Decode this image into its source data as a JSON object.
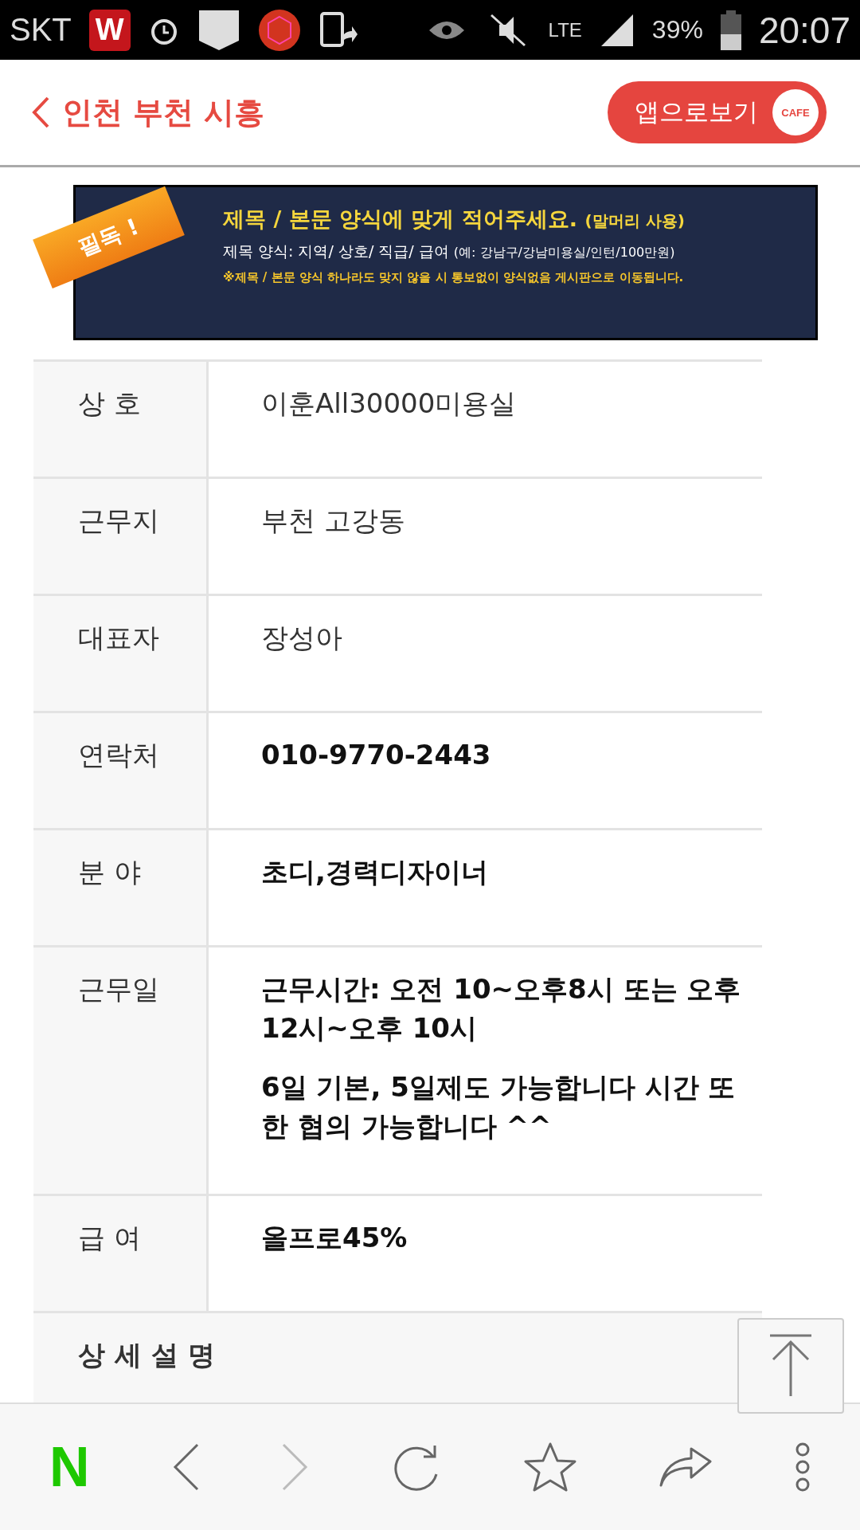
{
  "status_bar": {
    "carrier": "SKT",
    "app_badge": "W",
    "network": "LTE",
    "battery": "39%",
    "time": "20:07"
  },
  "header": {
    "back_label": "인천 부천 시흥",
    "app_button": "앱으로보기",
    "cafe_logo": "CAFE"
  },
  "notice_banner": {
    "ribbon": "필독 !",
    "headline": "제목 / 본문 양식에 맞게 적어주세요.",
    "headline_note": "(말머리 사용)",
    "format_line": "제목 양식: 지역/ 상호/ 직급/ 급여",
    "format_example": "(예: 강남구/강남미용실/인턴/100만원)",
    "warning": "※제목 / 본문 양식 하나라도 맞지 않을 시 통보없이 양식없음 게시판으로 이동됩니다."
  },
  "table": {
    "rows": [
      {
        "label": "상 호",
        "emphasis": false,
        "values": [
          "이훈All30000미용실"
        ]
      },
      {
        "label": "근무지",
        "emphasis": false,
        "values": [
          "부천 고강동"
        ]
      },
      {
        "label": "대표자",
        "emphasis": false,
        "values": [
          "장성아"
        ]
      },
      {
        "label": "연락처",
        "emphasis": true,
        "values": [
          "010-9770-2443"
        ]
      },
      {
        "label": "분 야",
        "emphasis": true,
        "values": [
          "초디,경력디자이너"
        ]
      },
      {
        "label": "근무일",
        "emphasis": true,
        "values": [
          "근무시간: 오전 10~오후8시 또는 오후12시~오후 10시",
          "6일 기본, 5일제도 가능합니다 시간 또한 협의 가능합니다 ^^"
        ]
      },
      {
        "label": "급 여",
        "emphasis": true,
        "values": [
          "올프로45%"
        ]
      }
    ],
    "section_title": "상 세 설 명"
  },
  "browser_toolbar": {
    "logo": "N",
    "forward_disabled": true
  }
}
